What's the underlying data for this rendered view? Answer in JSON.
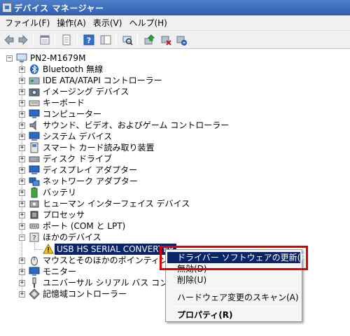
{
  "window": {
    "title": "デバイス マネージャー"
  },
  "menu": [
    "ファイル(F)",
    "操作(A)",
    "表示(V)",
    "ヘルプ(H)"
  ],
  "toolbar": [
    "back-icon",
    "forward-icon",
    "properties-view-icon",
    "show-hidden-icon",
    "help-icon",
    "console-tree-icon",
    "scan-hardware-icon",
    "update-driver-icon",
    "disable-device-icon",
    "uninstall-device-icon"
  ],
  "tree": {
    "root": "PN2-M1679M",
    "categories": [
      "Bluetooth 無線",
      "IDE ATA/ATAPI コントローラー",
      "イメージング デバイス",
      "キーボード",
      "コンピューター",
      "サウンド、ビデオ、およびゲーム コントローラー",
      "システム デバイス",
      "スマート カード読み取り装置",
      "ディスク ドライブ",
      "ディスプレイ アダプター",
      "ネットワーク アダプター",
      "バッテリ",
      "ヒューマン インターフェイス デバイス",
      "プロセッサ",
      "ポート (COM と LPT)",
      "ほかのデバイス"
    ],
    "other_device_child": "USB HS SERIAL CONVERTER",
    "categories_after": [
      "マウスとそのほかのポインティング デバイス",
      "モニター",
      "ユニバーサル シリアル バス コントローラー",
      "記憶域コントローラー"
    ]
  },
  "context_menu": {
    "update_driver": "ドライバー ソフトウェアの更新(P)...",
    "disable": "無効(D)",
    "uninstall": "削除(U)",
    "scan": "ハードウェア変更のスキャン(A)",
    "properties": "プロパティ(R)"
  },
  "colors": {
    "highlight_box": "#e10000",
    "selection": "#0a246a"
  }
}
